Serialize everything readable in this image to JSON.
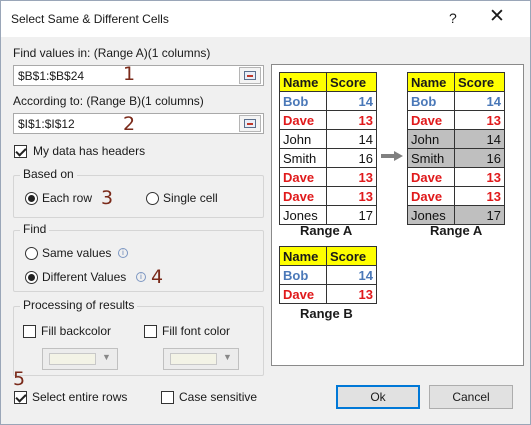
{
  "window": {
    "title": "Select Same & Different Cells",
    "help_glyph": "?",
    "close_glyph": "✕"
  },
  "range_a": {
    "label": "Find values in: (Range A)(1 columns)",
    "value": "$B$1:$B$24"
  },
  "range_b": {
    "label": "According to: (Range B)(1 columns)",
    "value": "$I$1:$I$12"
  },
  "headers": {
    "label": "My data has headers",
    "checked": true
  },
  "based_on": {
    "title": "Based on",
    "options": [
      {
        "label": "Each row",
        "checked": true
      },
      {
        "label": "Single cell",
        "checked": false
      }
    ]
  },
  "find": {
    "title": "Find",
    "options": [
      {
        "label": "Same values",
        "checked": false
      },
      {
        "label": "Different Values",
        "checked": true
      }
    ]
  },
  "processing": {
    "title": "Processing of results",
    "fill_backcolor": "Fill backcolor",
    "fill_fontcolor": "Fill font color"
  },
  "select_entire_rows": "Select entire rows",
  "case_sensitive": "Case sensitive",
  "buttons": {
    "ok": "Ok",
    "cancel": "Cancel"
  },
  "step_numbers": [
    "1",
    "2",
    "3",
    "4",
    "5"
  ],
  "preview": {
    "range_a_caption": "Range A",
    "range_b_caption": "Range B",
    "result_caption": "Range A",
    "header": [
      "Name",
      "Score"
    ],
    "range_a_rows": [
      {
        "name": "Bob",
        "score": "14",
        "style": "blue"
      },
      {
        "name": "Dave",
        "score": "13",
        "style": "red"
      },
      {
        "name": "John",
        "score": "14",
        "style": "black"
      },
      {
        "name": "Smith",
        "score": "16",
        "style": "black"
      },
      {
        "name": "Dave",
        "score": "13",
        "style": "red"
      },
      {
        "name": "Dave",
        "score": "13",
        "style": "red"
      },
      {
        "name": "Jones",
        "score": "17",
        "style": "black"
      }
    ],
    "range_b_rows": [
      {
        "name": "Bob",
        "score": "14",
        "style": "blue"
      },
      {
        "name": "Dave",
        "score": "13",
        "style": "red"
      }
    ],
    "highlighted_rows": [
      2,
      3,
      6
    ],
    "colors": {
      "header_bg": "#ffff00",
      "blue": "#4a78b8",
      "red": "#e0191b",
      "highlight": "#bfbfbf",
      "accent": "#0078d7"
    }
  }
}
